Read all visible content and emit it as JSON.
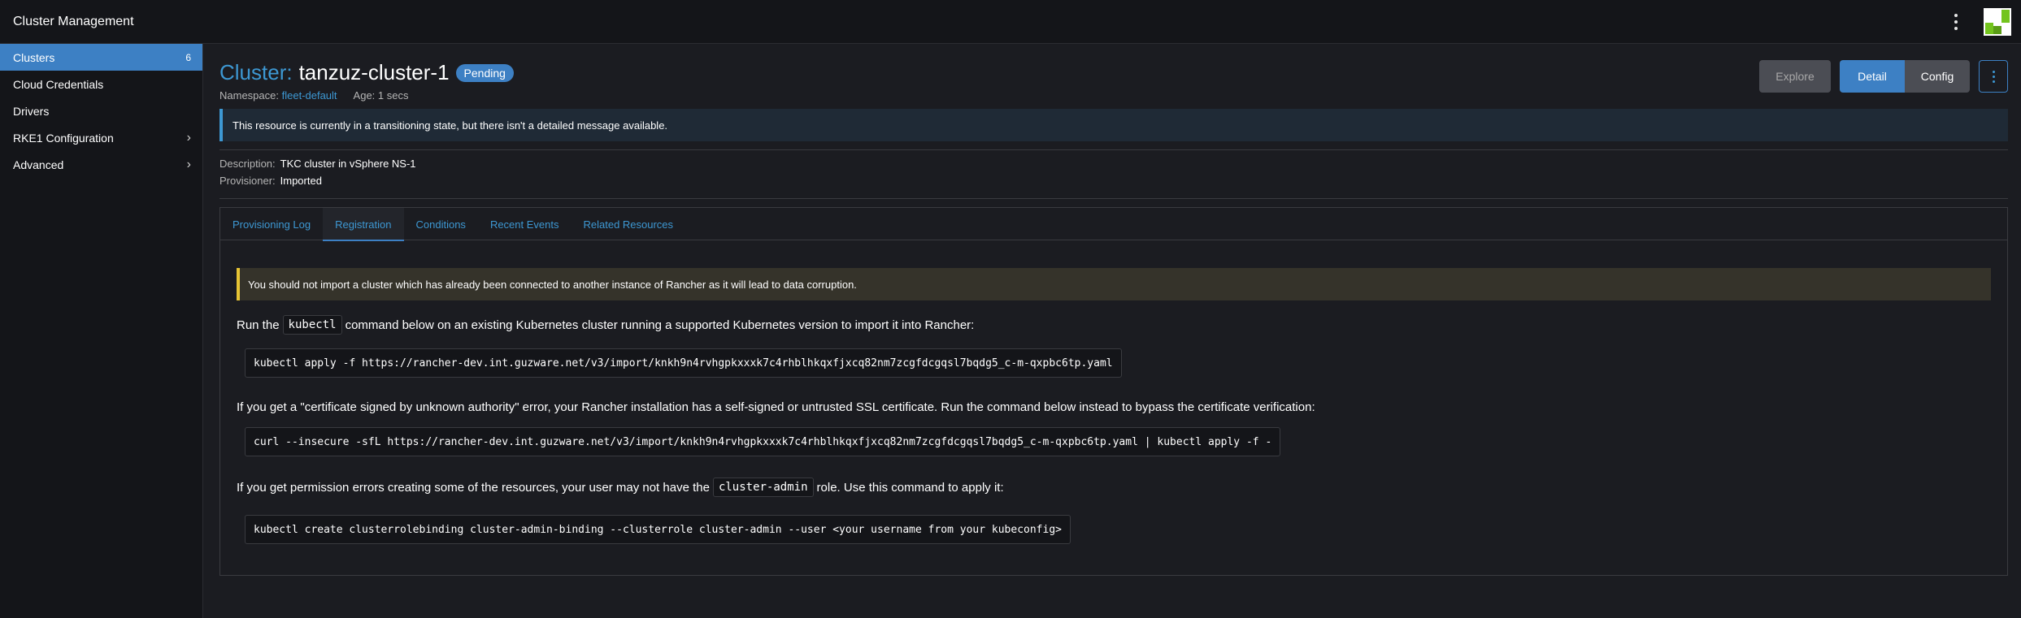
{
  "header": {
    "app_title": "Cluster Management"
  },
  "sidebar": {
    "items": [
      {
        "label": "Clusters",
        "count": "6"
      },
      {
        "label": "Cloud Credentials"
      },
      {
        "label": "Drivers"
      },
      {
        "label": "RKE1 Configuration"
      },
      {
        "label": "Advanced"
      }
    ]
  },
  "page": {
    "title_prefix": "Cluster:",
    "cluster_name": "tanzuz-cluster-1",
    "state_badge": "Pending",
    "namespace_label": "Namespace:",
    "namespace_value": "fleet-default",
    "age": "Age: 1 secs",
    "buttons": {
      "explore": "Explore",
      "detail": "Detail",
      "config": "Config"
    },
    "transition_banner": "This resource is currently in a transitioning state, but there isn't a detailed message available.",
    "description_label": "Description:",
    "description_value": "TKC cluster in vSphere NS-1",
    "provisioner_label": "Provisioner:",
    "provisioner_value": "Imported"
  },
  "tabs": [
    "Provisioning Log",
    "Registration",
    "Conditions",
    "Recent Events",
    "Related Resources"
  ],
  "active_tab": "Registration",
  "registration": {
    "warning": "You should not import a cluster which has already been connected to another instance of Rancher as it will lead to data corruption.",
    "run_prefix": "Run the",
    "run_code": "kubectl",
    "run_suffix": "command below on an existing Kubernetes cluster running a supported Kubernetes version to import it into Rancher:",
    "cmd_apply": "kubectl apply -f https://rancher-dev.int.guzware.net/v3/import/knkh9n4rvhgpkxxxk7c4rhblhkqxfjxcq82nm7zcgfdcgqsl7bqdg5_c-m-qxpbc6tp.yaml",
    "cert_text": "If you get a \"certificate signed by unknown authority\" error, your Rancher installation has a self-signed or untrusted SSL certificate. Run the command below instead to bypass the certificate verification:",
    "cmd_curl": "curl --insecure -sfL https://rancher-dev.int.guzware.net/v3/import/knkh9n4rvhgpkxxxk7c4rhblhkqxfjxcq82nm7zcgfdcgqsl7bqdg5_c-m-qxpbc6tp.yaml | kubectl apply -f -",
    "perm_prefix": "If you get permission errors creating some of the resources, your user may not have the",
    "perm_code": "cluster-admin",
    "perm_suffix": "role. Use this command to apply it:",
    "cmd_binding": "kubectl create clusterrolebinding cluster-admin-binding --clusterrole cluster-admin --user <your username from your kubeconfig>"
  },
  "colors": {
    "accent": "#3d80c4",
    "link": "#3d98d3",
    "warning_border": "#e6c434",
    "background": "#1b1c21"
  }
}
